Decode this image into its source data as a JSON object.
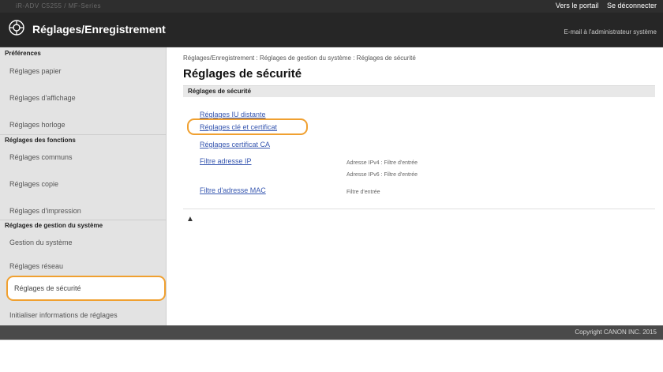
{
  "topbar": {
    "device_name": "iR-ADV C5255 / MF-Series",
    "portal_link": "Vers le portail",
    "logout_link": "Se déconnecter"
  },
  "header": {
    "title": "Réglages/Enregistrement",
    "email_admin": "E-mail à l'administrateur système",
    "icon": "gear-icon"
  },
  "sidebar": {
    "sections": [
      {
        "heading": "Préférences",
        "items": [
          "Réglages papier",
          "Réglages d'affichage",
          "Réglages horloge"
        ]
      },
      {
        "heading": "Réglages des fonctions",
        "items": [
          "Réglages communs",
          "Réglages copie",
          "Réglages d'impression"
        ]
      },
      {
        "heading": "Réglages de gestion du système",
        "items": [
          "Gestion du système",
          "Réglages réseau",
          "Réglages de sécurité",
          "Initialiser informations de réglages"
        ]
      }
    ],
    "active_item": "Réglages de sécurité"
  },
  "main": {
    "breadcrumb": "Réglages/Enregistrement : Réglages de gestion du système : Réglages de sécurité",
    "page_title": "Réglages de sécurité",
    "section_title": "Réglages de sécurité",
    "links": [
      {
        "label": "Réglages IU distante",
        "info": ""
      },
      {
        "label": "Réglages clé et certificat",
        "info": ""
      },
      {
        "label": "Réglages certificat CA",
        "info": ""
      },
      {
        "label": "Filtre adresse IP",
        "info": "Adresse IPv4 : Filtre d'entrée"
      },
      {
        "label": "",
        "info": "Adresse IPv6 : Filtre d'entrée"
      },
      {
        "label": "Filtre d'adresse MAC",
        "info": "Filtre d'entrée"
      }
    ],
    "back_to_top": "▲"
  },
  "footer": {
    "copyright": "Copyright CANON INC. 2015"
  },
  "colors": {
    "highlight": "#f0a030",
    "link": "#3757b0",
    "header_bg": "#262626"
  }
}
